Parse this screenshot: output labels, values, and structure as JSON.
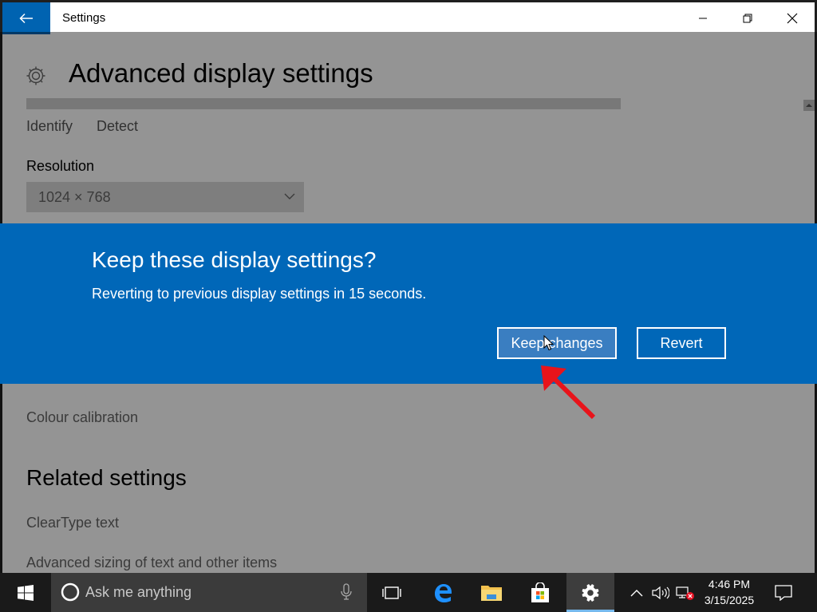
{
  "window": {
    "title": "Settings"
  },
  "page": {
    "title": "Advanced display settings",
    "identify": "Identify",
    "detect": "Detect",
    "resolution_label": "Resolution",
    "resolution_value": "1024 × 768",
    "colour_calibration": "Colour calibration",
    "related_title": "Related settings",
    "cleartype": "ClearType text",
    "advanced_sizing": "Advanced sizing of text and other items"
  },
  "dialog": {
    "title": "Keep these display settings?",
    "message": "Reverting to previous display settings in 15 seconds.",
    "keep_label": "Keep changes",
    "revert_label": "Revert"
  },
  "taskbar": {
    "search_placeholder": "Ask me anything",
    "time": "4:46 PM",
    "date": "3/15/2025"
  },
  "colors": {
    "accent": "#0067b8",
    "back_button": "#0063b1",
    "taskbar": "#1a1a1a",
    "annotation_arrow": "#e8141b"
  },
  "icons": {
    "back": "arrow-left-icon",
    "settings": "gear-icon",
    "start": "windows-logo-icon",
    "cortana": "cortana-circle-icon",
    "mic": "microphone-icon",
    "taskview": "task-view-icon",
    "edge": "edge-browser-icon",
    "explorer": "file-explorer-icon",
    "store": "store-icon",
    "tray": "chevron-up-icon",
    "volume": "speaker-icon",
    "network": "network-error-icon",
    "notifications": "action-center-icon"
  }
}
